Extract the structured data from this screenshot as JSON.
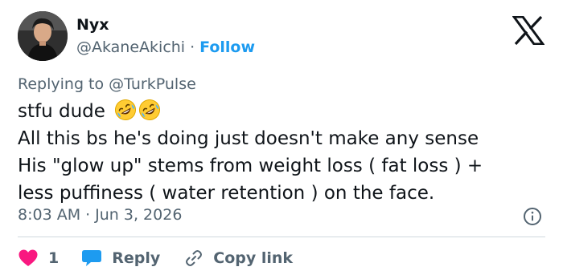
{
  "user": {
    "display_name": "Nyx",
    "handle": "@AkaneAkichi",
    "separator": "·",
    "follow_label": "Follow"
  },
  "reply_context": {
    "prefix": "Replying to",
    "mention": "@TurkPulse"
  },
  "tweet": {
    "lines": [
      "stfu dude",
      "All this bs he's doing just doesn't make any sense",
      "His \"glow up\" stems from weight loss ( fat loss ) +",
      "less puffiness ( water retention ) on the face."
    ],
    "emoji": [
      "rolling-on-floor-laughing-emoji",
      "rolling-on-floor-laughing-emoji"
    ]
  },
  "meta": {
    "time": "8:03 AM",
    "separator": "·",
    "date": "Jun 3, 2026"
  },
  "actions": {
    "like_count": "1",
    "reply_label": "Reply",
    "copy_link_label": "Copy link"
  },
  "colors": {
    "text": "#0f1419",
    "secondary": "#536471",
    "link": "#1d9bf0",
    "like": "#f91880",
    "divider": "#cfd9de"
  },
  "icons": {
    "platform": "x-logo-icon",
    "info": "info-icon",
    "like": "heart-icon",
    "reply": "reply-bubble-icon",
    "copy": "link-icon"
  }
}
